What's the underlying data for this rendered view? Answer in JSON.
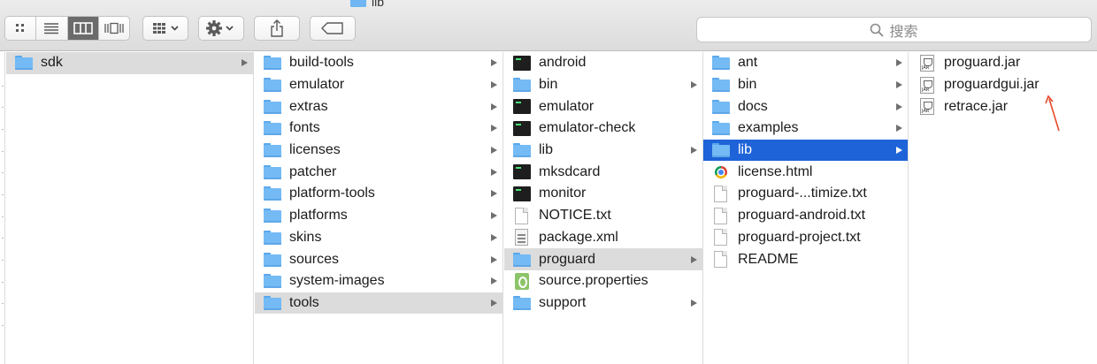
{
  "window": {
    "title": "lib"
  },
  "toolbar": {
    "search_placeholder": "搜索"
  },
  "columns": [
    {
      "items": [
        {
          "label": "sdk",
          "icon": "folder-icon",
          "arrow": true,
          "selected": "grey"
        }
      ]
    },
    {
      "items": [
        {
          "label": "build-tools",
          "icon": "folder-icon",
          "arrow": true
        },
        {
          "label": "emulator",
          "icon": "folder-icon",
          "arrow": true
        },
        {
          "label": "extras",
          "icon": "folder-icon",
          "arrow": true
        },
        {
          "label": "fonts",
          "icon": "folder-icon",
          "arrow": true
        },
        {
          "label": "licenses",
          "icon": "folder-icon",
          "arrow": true
        },
        {
          "label": "patcher",
          "icon": "folder-icon",
          "arrow": true
        },
        {
          "label": "platform-tools",
          "icon": "folder-icon",
          "arrow": true
        },
        {
          "label": "platforms",
          "icon": "folder-icon",
          "arrow": true
        },
        {
          "label": "skins",
          "icon": "folder-icon",
          "arrow": true
        },
        {
          "label": "sources",
          "icon": "folder-icon",
          "arrow": true
        },
        {
          "label": "system-images",
          "icon": "folder-icon",
          "arrow": true
        },
        {
          "label": "tools",
          "icon": "folder-icon",
          "arrow": true,
          "selected": "grey"
        }
      ]
    },
    {
      "items": [
        {
          "label": "android",
          "icon": "exec-icon",
          "arrow": false
        },
        {
          "label": "bin",
          "icon": "folder-icon",
          "arrow": true
        },
        {
          "label": "emulator",
          "icon": "exec-icon",
          "arrow": false
        },
        {
          "label": "emulator-check",
          "icon": "exec-icon",
          "arrow": false
        },
        {
          "label": "lib",
          "icon": "folder-icon",
          "arrow": true
        },
        {
          "label": "mksdcard",
          "icon": "exec-icon",
          "arrow": false
        },
        {
          "label": "monitor",
          "icon": "exec-icon",
          "arrow": false
        },
        {
          "label": "NOTICE.txt",
          "icon": "doc-icon",
          "arrow": false
        },
        {
          "label": "package.xml",
          "icon": "xml-icon",
          "arrow": false
        },
        {
          "label": "proguard",
          "icon": "folder-icon",
          "arrow": true,
          "selected": "grey"
        },
        {
          "label": "source.properties",
          "icon": "props-icon",
          "arrow": false
        },
        {
          "label": "support",
          "icon": "folder-icon",
          "arrow": true
        }
      ]
    },
    {
      "items": [
        {
          "label": "ant",
          "icon": "folder-icon",
          "arrow": true
        },
        {
          "label": "bin",
          "icon": "folder-icon",
          "arrow": true
        },
        {
          "label": "docs",
          "icon": "folder-icon",
          "arrow": true
        },
        {
          "label": "examples",
          "icon": "folder-icon",
          "arrow": true
        },
        {
          "label": "lib",
          "icon": "folder-icon",
          "arrow": true,
          "selected": "blue"
        },
        {
          "label": "license.html",
          "icon": "chrome-icon",
          "arrow": false
        },
        {
          "label": "proguard-...timize.txt",
          "icon": "doc-icon",
          "arrow": false
        },
        {
          "label": "proguard-android.txt",
          "icon": "doc-icon",
          "arrow": false
        },
        {
          "label": "proguard-project.txt",
          "icon": "doc-icon",
          "arrow": false
        },
        {
          "label": "README",
          "icon": "doc-icon",
          "arrow": false
        }
      ]
    },
    {
      "items": [
        {
          "label": "proguard.jar",
          "icon": "jar-icon",
          "arrow": false
        },
        {
          "label": "proguardgui.jar",
          "icon": "jar-icon",
          "arrow": false
        },
        {
          "label": "retrace.jar",
          "icon": "jar-icon",
          "arrow": false
        }
      ]
    }
  ],
  "colors": {
    "selection_blue": "#1e63d8",
    "selection_grey": "#dcdcdc",
    "folder": "#74baf4",
    "annotation_arrow": "#e8492a"
  }
}
